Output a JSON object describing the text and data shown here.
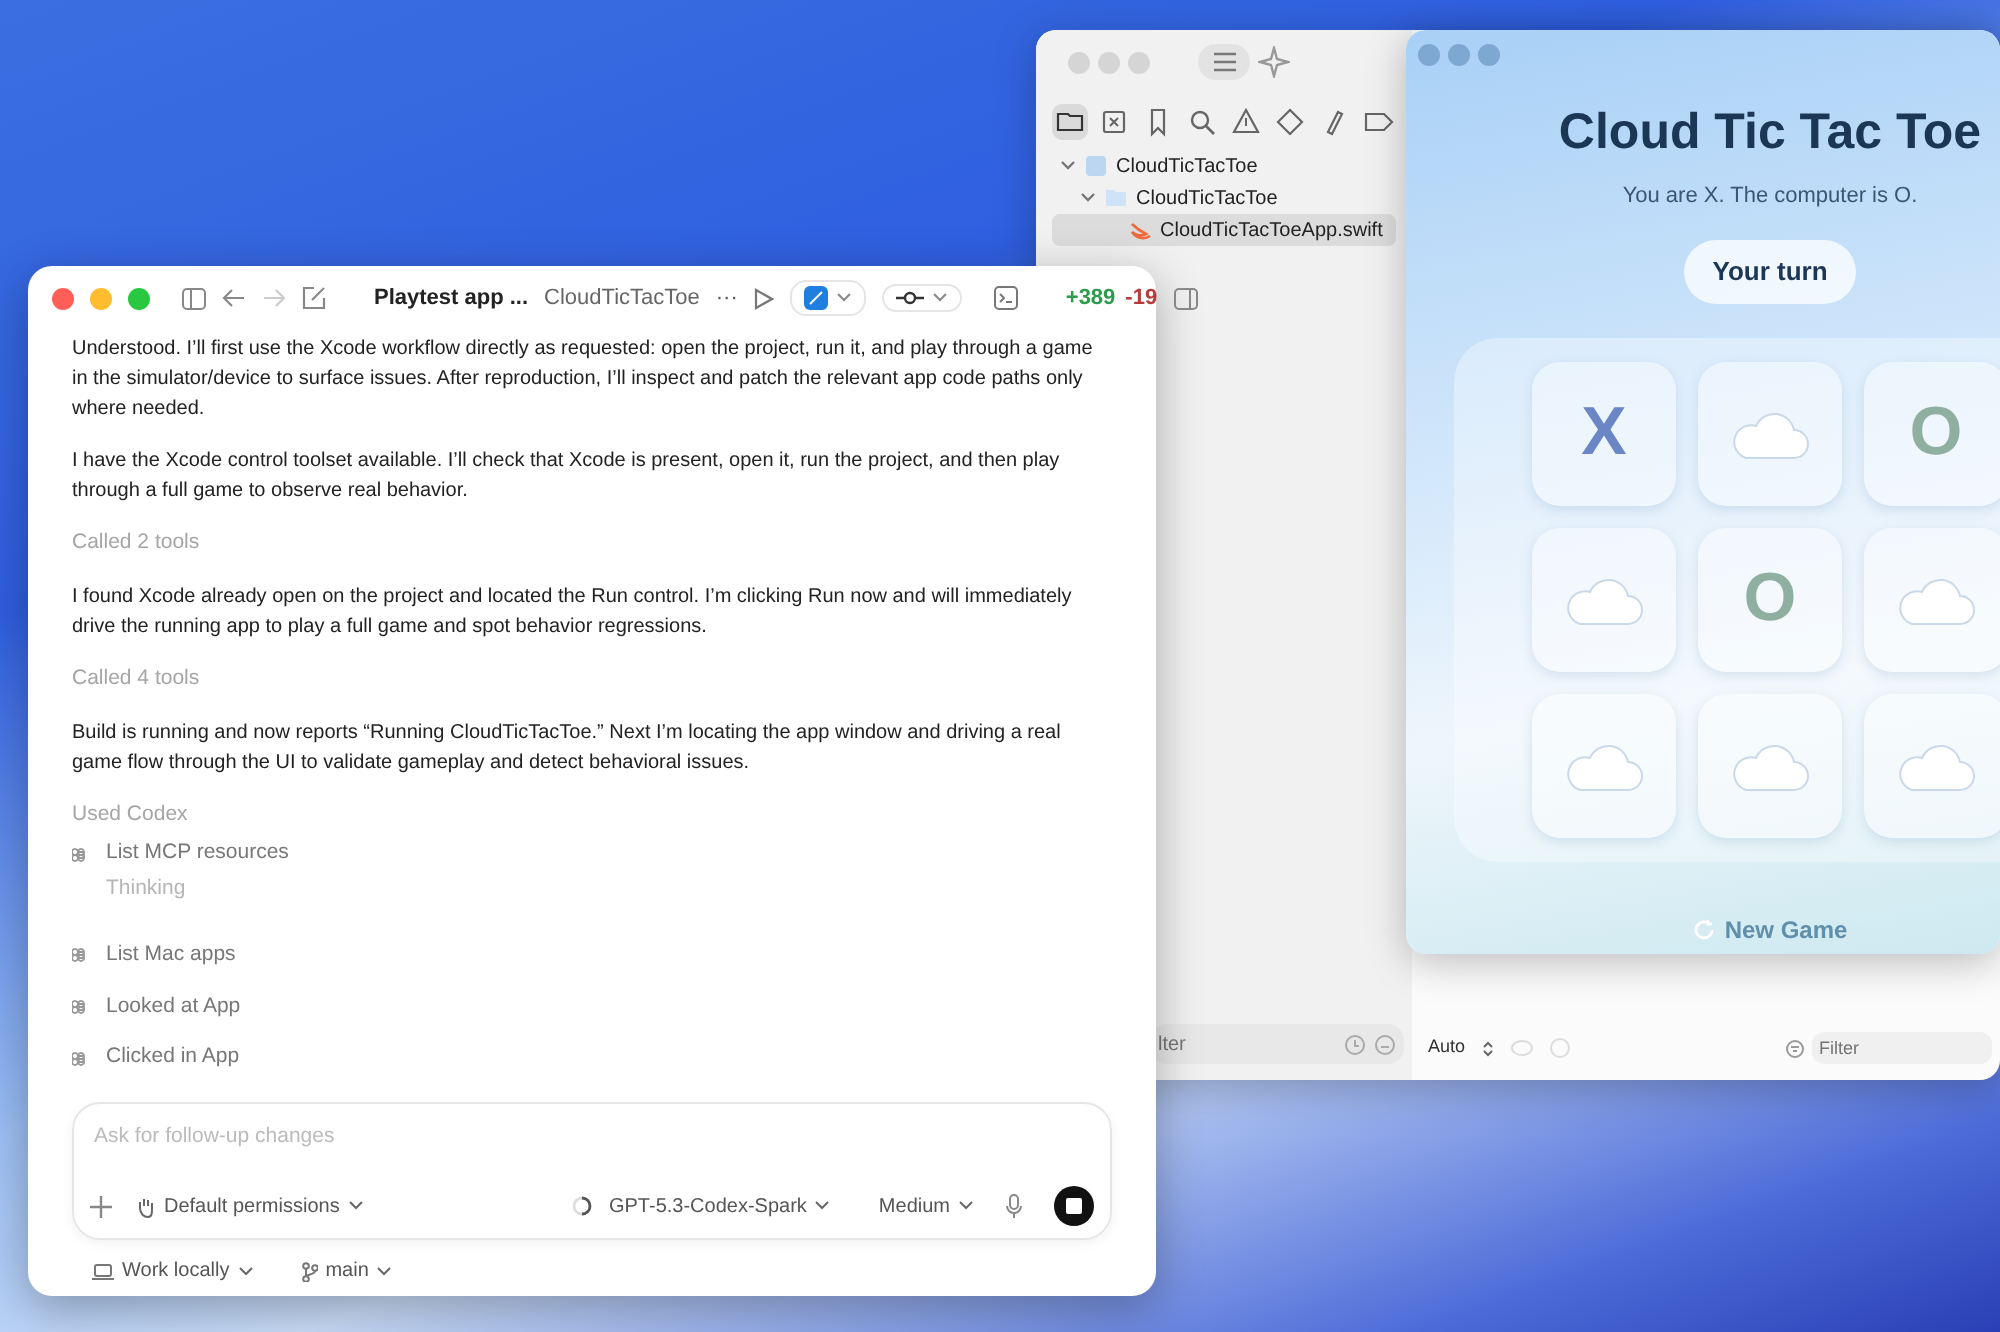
{
  "xcode": {
    "navigator_tabs": [
      {
        "selected": true
      },
      {
        "selected": false
      },
      {
        "selected": false
      },
      {
        "selected": false
      },
      {
        "selected": false
      },
      {
        "selected": false
      },
      {
        "selected": false
      },
      {
        "selected": false
      }
    ],
    "tree": [
      {
        "label": "CloudTicTacToe",
        "kind": "project",
        "expanded": true,
        "selected": false,
        "children": [
          {
            "label": "CloudTicTacToe",
            "kind": "folder",
            "expanded": true,
            "selected": false,
            "children": [
              {
                "label": "CloudTicTacToeApp.swift",
                "kind": "swift",
                "selected": true
              }
            ]
          }
        ]
      }
    ],
    "navigator_filter": "lter",
    "scheme": "Auto",
    "console_filter": {
      "placeholder": "Filter"
    }
  },
  "game": {
    "title": "Cloud Tic Tac Toe",
    "subtitle": "You are X. The computer is O.",
    "status": "Your turn",
    "cells": [
      {
        "kind": "x",
        "text": "X"
      },
      {
        "kind": "cloud"
      },
      {
        "kind": "o",
        "text": "O"
      },
      {
        "kind": "cloud"
      },
      {
        "kind": "o",
        "text": "O"
      },
      {
        "kind": "cloud"
      },
      {
        "kind": "cloud"
      },
      {
        "kind": "cloud"
      },
      {
        "kind": "cloud"
      }
    ],
    "new_game": "New Game"
  },
  "codex": {
    "title": "Playtest app ...",
    "project": "CloudTicTacToe",
    "more": "···",
    "added": "+389",
    "removed": "-19",
    "transcript": [
      {
        "kind": "message",
        "text": "Understood. I’ll first use the Xcode workflow directly as requested: open the project, run it, and play through a game in the simulator/device to surface issues. After reproduction, I’ll inspect and patch the relevant app code paths only where needed."
      },
      {
        "kind": "message",
        "text": "I have the Xcode control toolset available. I’ll check that Xcode is present, open it, run the project, and then play through a full game to observe real behavior."
      },
      {
        "kind": "note",
        "text": "Called 2 tools"
      },
      {
        "kind": "message",
        "text": "I found Xcode already open on the project and located the Run control. I’m clicking Run now and will immediately drive the running app to play a full game and spot behavior regressions."
      },
      {
        "kind": "note",
        "text": "Called 4 tools"
      },
      {
        "kind": "message",
        "text": "Build is running and now reports “Running CloudTicTacToe.” Next I’m locating the app window and driving a real game flow through the UI to validate gameplay and detect behavioral issues."
      },
      {
        "kind": "note",
        "text": "Used Codex"
      },
      {
        "kind": "tool",
        "text": "List MCP resources",
        "status": "Thinking"
      },
      {
        "kind": "tool",
        "text": "List Mac apps"
      },
      {
        "kind": "tool",
        "text": "Looked at App"
      },
      {
        "kind": "tool",
        "text": "Clicked in App"
      }
    ],
    "composer": {
      "placeholder": "Ask for follow-up changes",
      "permissions": "Default permissions",
      "model": "GPT-5.3-Codex-Spark",
      "effort": "Medium"
    },
    "environment": "Work locally",
    "branch": "main"
  }
}
